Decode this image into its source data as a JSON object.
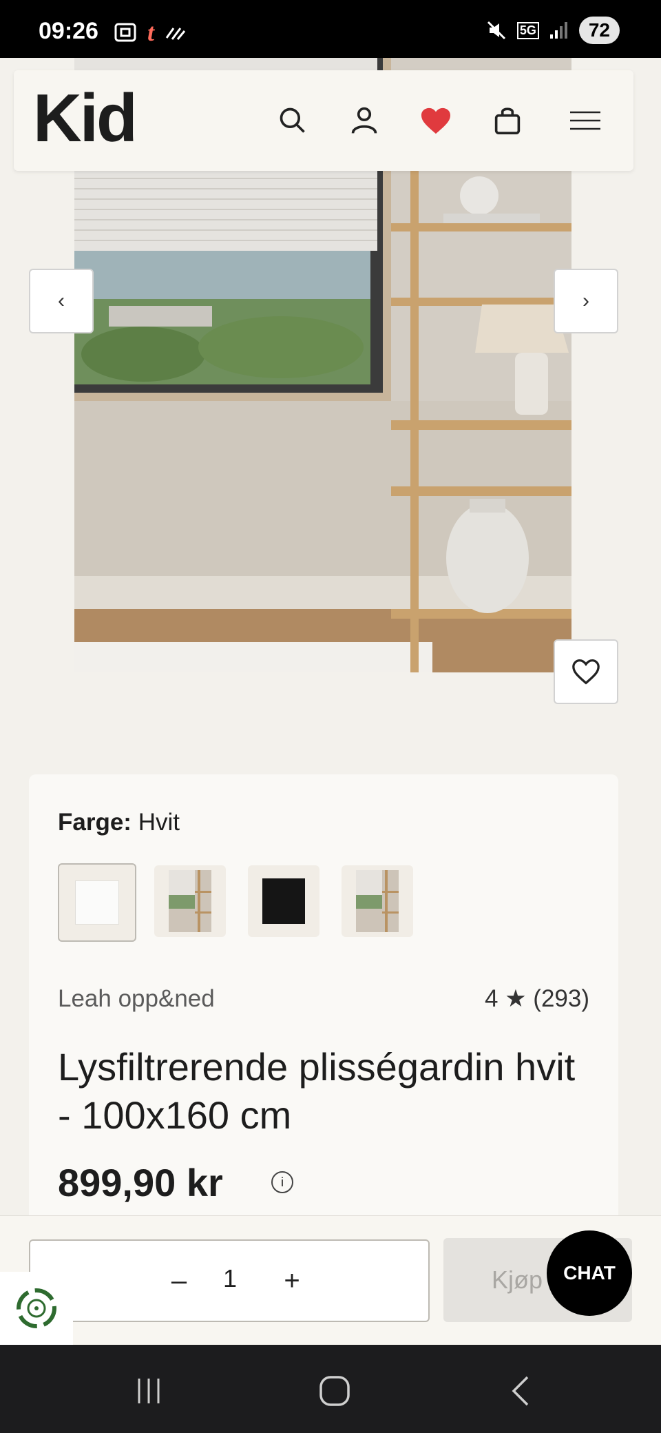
{
  "status_bar": {
    "time": "09:26",
    "network": "5G",
    "battery": "72"
  },
  "header": {
    "logo": "Kid"
  },
  "product": {
    "color_label": "Farge:",
    "color_value": "Hvit",
    "brand": "Leah opp&ned",
    "rating": "4 ★ (293)",
    "title": "Lysfiltrerende plisségardin hvit - 100x160 cm",
    "price": "899,90 kr",
    "info_icon": "i"
  },
  "cart": {
    "decrement": "–",
    "quantity": "1",
    "increment": "+",
    "buy_label": "Kjøp"
  },
  "chat": {
    "label": "CHAT"
  },
  "colors": {
    "brand_heart": "#e03a3e",
    "card_bg": "#faf9f6",
    "page_bg": "#f3f1ec"
  }
}
